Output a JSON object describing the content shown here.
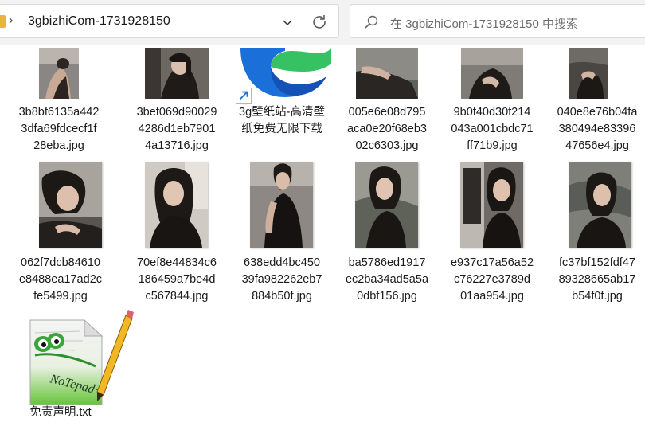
{
  "address_bar": {
    "path": "3gbizhiCom-1731928150"
  },
  "search": {
    "placeholder": "在 3gbizhiCom-1731928150 中搜索"
  },
  "files": [
    {
      "name": "3b8bf6135a4423dfa69fdcecf1f28eba.jpg",
      "label": "3b8bf6135a442\n3dfa69fdcecf1f\n28eba.jpg",
      "kind": "image"
    },
    {
      "name": "3bef069d900294286d1eb79014a13716.jpg",
      "label": "3bef069d90029\n4286d1eb7901\n4a13716.jpg",
      "kind": "image"
    },
    {
      "name": "3g壁纸站-高清壁纸免费无限下载",
      "label": "3g壁纸站-高清壁\n纸免费无限下载",
      "kind": "shortcut"
    },
    {
      "name": "005e6e08d795aca0e20f68eb302c6303.jpg",
      "label": "005e6e08d795\naca0e20f68eb3\n02c6303.jpg",
      "kind": "image"
    },
    {
      "name": "9b0f40d30f214043a001cbdc71ff71b9.jpg",
      "label": "9b0f40d30f214\n043a001cbdc71\nff71b9.jpg",
      "kind": "image"
    },
    {
      "name": "040e8e76b04fa380494e8339647656e4.jpg",
      "label": "040e8e76b04fa\n380494e83396\n47656e4.jpg",
      "kind": "image"
    },
    {
      "name": "062f7dcb84610e8488ea17ad2cfe5499.jpg",
      "label": "062f7dcb84610\ne8488ea17ad2c\nfe5499.jpg",
      "kind": "image"
    },
    {
      "name": "70ef8e44834c6186459a7be4dc567844.jpg",
      "label": "70ef8e44834c6\n186459a7be4d\nc567844.jpg",
      "kind": "image"
    },
    {
      "name": "638edd4bc45039fa982262eb7884b50f.jpg",
      "label": "638edd4bc450\n39fa982262eb7\n884b50f.jpg",
      "kind": "image"
    },
    {
      "name": "ba5786ed1917ec2ba34ad5a5a0dbf156.jpg",
      "label": "ba5786ed1917\nec2ba34ad5a5a\n0dbf156.jpg",
      "kind": "image"
    },
    {
      "name": "e937c17a56a52c76227e3789d01aa954.jpg",
      "label": "e937c17a56a52\nc76227e3789d\n01aa954.jpg",
      "kind": "image"
    },
    {
      "name": "fc37bf152fdf4789328665ab17b54f0f.jpg",
      "label": "fc37bf152fdf47\n89328665ab17\nb54f0f.jpg",
      "kind": "image"
    },
    {
      "name": "免责声明.txt",
      "label": "免责声明.txt",
      "kind": "notepad"
    }
  ],
  "icons": {
    "folder": "folder-icon",
    "chevron": "chevron-right-icon",
    "dropdown": "chevron-down-icon",
    "refresh": "refresh-icon",
    "search": "search-icon",
    "edge": "edge-logo-icon",
    "shortcut": "shortcut-arrow-icon",
    "notepad": "notepadplusplus-icon"
  },
  "colors": {
    "folder": "#e8b53b",
    "edge_blue": "#1b6fd8",
    "edge_green": "#36c262"
  }
}
